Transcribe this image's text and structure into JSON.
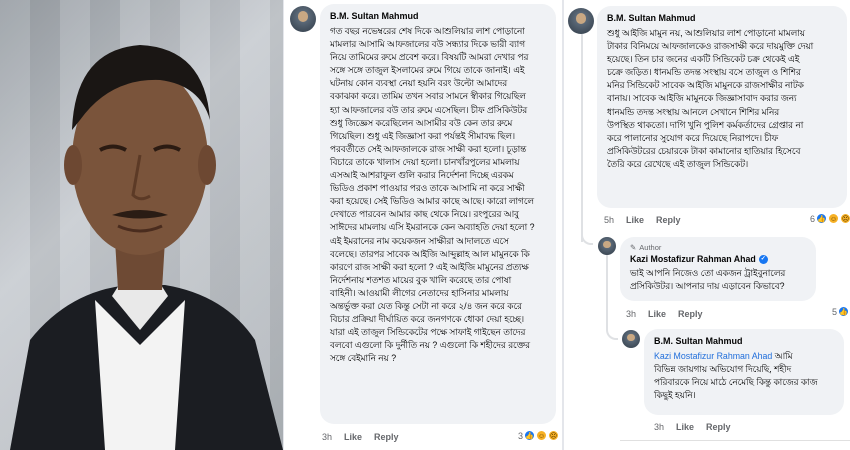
{
  "left_comment": {
    "author": "B.M. Sultan Mahmud",
    "lines": [
      "গত বছর নভেম্বরের শেষ দিকে আশুলিয়ার লাশ পোড়ানো",
      "মামলার আসামি আফজালের বউ সন্ধ্যার দিকে ভারী ব্যাগ",
      "নিয়ে তামিমের রুমে প্রবেশ করে। বিষয়টি আমরা দেখার পর",
      "সঙ্গে সঙ্গে তাজুল ইসলামের রুমে গিয়ে তাকে জানাই। এই",
      "ঘটনায় কোন ব্যবস্থা নেয়া হয়নি বরং উল্টো আমাদের",
      "বকাঝকা করে। তামিম তখন সবার সামনে স্বীকার গিয়েছিল",
      "হ্যা আফজালের বউ তার রুমে এসেছিল। চীফ প্রসিকিউটর",
      "শুধু জিজ্ঞেস করেছিলেন আসামীর বউ কেন তার রুমে",
      "গিয়েছিল। শুধু এই জিজ্ঞাসা করা পর্যন্তই সীমাবদ্ধ ছিল।",
      "পরবর্তীতে সেই আফজালকে রাজ সাক্ষী করা হলো। চূড়ান্ত",
      "বিচারে তাকে খালাস দেয়া হলো। চানখাঁরপুলের মামলায়",
      "এসআই আশরাফুল গুলি করার নির্দেশনা দিচ্ছে এরকম",
      "ভিডিও প্রকাশ পাওয়ার পরও তাকে আসামি না করে সাক্ষী",
      "করা হয়েছে। সেই ভিডিও আমার কাছে আছে। কারো লাগলে",
      "দেখাতে পারবেন আমার কাছ থেকে নিয়ে। রংপুরের আবু",
      "সাঈদের মামলায় এসি ইমরানকে কেন অব্যাহতি দেয়া হলো ?",
      "এই ইমরানের নাম কয়েকজন সাক্ষীরা আদালতে এসে",
      "বলেছে। তারপর সাবেক আইজি আব্দুল্লাহ আল মামুনকে কি",
      "কারণে রাজ সাক্ষী করা হলো ? এই আইজি মামুনের প্রত্যক্ষ",
      "নির্দেশনায় শতশত মায়ের বুক খালি করেছে তার পোষা",
      "বাহিনী। আওয়ামী লীগের নেতাদের হাসিনার মামলায়",
      "অন্তর্ভুক্ত করা যেত কিন্তু সেটা না করে ২/৪ জন করে করে",
      "বিচার প্রক্রিয়া দীর্ঘায়িত করে জনগণকে ধোকা দেয়া হচ্ছে।",
      "যারা এই তাজুল সিন্ডিকেটের পক্ষে সাফাই গাইছেন তাদের",
      "বলবো এগুলো কি দুর্নীতি নয় ? এগুলো কি শহীদের রক্তের",
      "সঙ্গে বেইমানি নয় ?"
    ],
    "time": "3h",
    "like": "Like",
    "reply": "Reply",
    "react_count": "3"
  },
  "right_comment": {
    "author": "B.M. Sultan Mahmud",
    "lines": [
      "শুধু আইজি মামুন নয়, আশুলিয়ার লাশ পোড়ানো মামলায়",
      "টাকার বিনিময়ে আফজালকেও রাজসাক্ষী করে দায়মুক্তি দেয়া",
      "হয়েছে। তিন চার জনের একটি সিন্ডিকেট চক্র থেকেই এই",
      "চক্রে জড়িত। ধানমন্ডি তদন্ত সংস্থায় বসে তাজুল ও শিশির",
      "মনির সিন্ডিকেট সাবেক আইজি মামুনকে রাজসাক্ষীর নাটক",
      "বানায়। সাবেক আইজি মামুনকে জিজ্ঞাসাবাদ করার জন্য",
      "ধানমন্ডি তদন্ত সংস্থায় আনলে সেখানে শিশির মনির",
      "উপস্থিত থাকতো। দাগি খুনি পুলিশ কর্মকর্তাদের গ্রেপ্তার না",
      "করে পালানোর সুযোগ করে দিয়েছে নিরাপদে। চীফ",
      "প্রসিকিউটরের চেয়ারকে টাকা কামানোর হাতিয়ার হিসেবে",
      "তৈরি করে রেখেছে এই তাজুল সিন্ডিকেট।"
    ],
    "time": "5h",
    "like": "Like",
    "reply": "Reply",
    "react_count": "6"
  },
  "reply_1": {
    "author_tag": "Author",
    "author": "Kazi Mostafizur Rahman Ahad",
    "lines": [
      "ভাই আপনি নিজেও তো একজন ট্রাইবুনালের",
      "প্রসিকিউটর। আপনার দায় এড়াবেন কিভাবে?"
    ],
    "time": "3h",
    "like": "Like",
    "reply": "Reply",
    "react_count": "5"
  },
  "reply_2": {
    "author": "B.M. Sultan Mahmud",
    "mention": "Kazi Mostafizur Rahman Ahad",
    "first_line_rest": " আমি",
    "lines": [
      "বিভিন্ন জায়গায় অভিযোগ দিয়েছি, শহীদ",
      "পরিবারকে নিয়ে মাঠে নেমেছি কিন্তু কাজের কাজ",
      "কিছুই হয়নি।"
    ],
    "time": "3h",
    "like": "Like",
    "reply": "Reply"
  },
  "colors": {
    "bubble": "#f0f2f5",
    "meta": "#65676b",
    "link": "#216fdb",
    "like_blue": "#1877f2"
  },
  "icons": [
    "avatar",
    "like-reaction-icon",
    "haha-reaction-icon",
    "sad-reaction-icon",
    "verified-badge-icon",
    "pencil-icon"
  ]
}
